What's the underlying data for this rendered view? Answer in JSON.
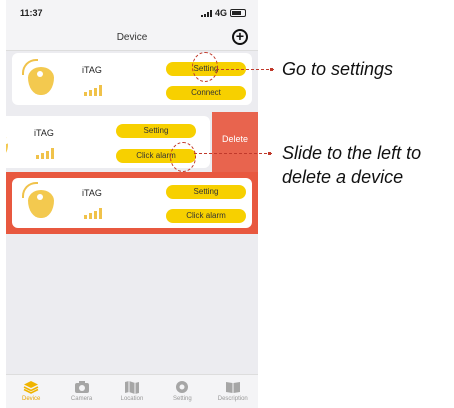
{
  "status": {
    "time": "11:37",
    "network": "4G"
  },
  "nav": {
    "title": "Device",
    "add_glyph": "+"
  },
  "devices": [
    {
      "name": "iTAG",
      "primary_label": "Setting",
      "secondary_label": "Connect"
    },
    {
      "name": "iTAG",
      "primary_label": "Setting",
      "secondary_label": "Click alarm"
    },
    {
      "name": "iTAG",
      "primary_label": "Setting",
      "secondary_label": "Click alarm"
    }
  ],
  "delete_label": "Delete",
  "tabs": [
    {
      "label": "Device",
      "icon": "layers-icon",
      "active": true
    },
    {
      "label": "Camera",
      "icon": "camera-icon",
      "active": false
    },
    {
      "label": "Location",
      "icon": "map-icon",
      "active": false
    },
    {
      "label": "Setting",
      "icon": "gear-icon",
      "active": false
    },
    {
      "label": "Description",
      "icon": "book-icon",
      "active": false
    }
  ],
  "callouts": {
    "settings": "Go to settings",
    "delete_line1": "Slide to the left to",
    "delete_line2": "delete a device"
  },
  "colors": {
    "accent": "#f7d000",
    "annotation": "#c0392b",
    "delete": "#e8644e"
  }
}
